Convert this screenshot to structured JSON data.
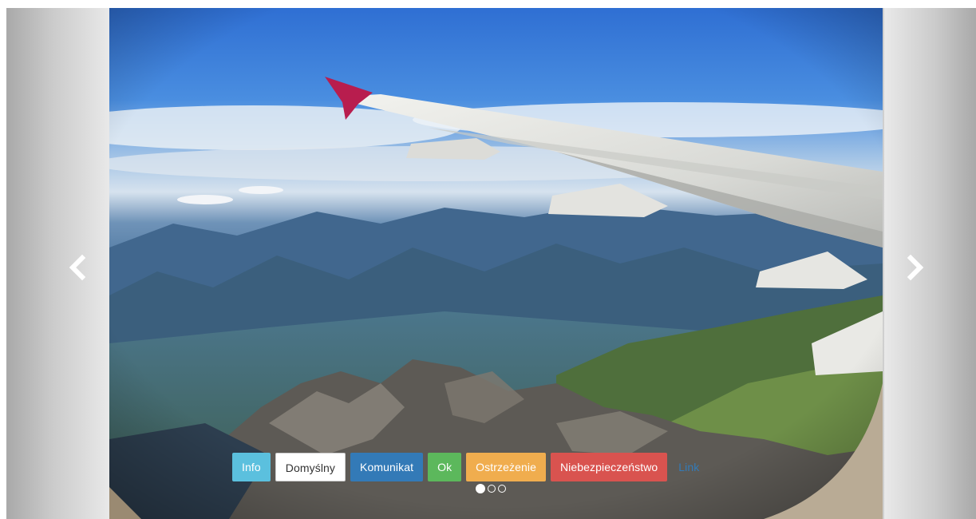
{
  "carousel": {
    "slide_image": "aerial-view-airplane-wing-over-mountains",
    "prev_icon": "chevron-left-icon",
    "next_icon": "chevron-right-icon",
    "buttons": [
      {
        "label": "Info",
        "style": "info"
      },
      {
        "label": "Domyślny",
        "style": "default"
      },
      {
        "label": "Komunikat",
        "style": "primary"
      },
      {
        "label": "Ok",
        "style": "success"
      },
      {
        "label": "Ostrzeżenie",
        "style": "warning"
      },
      {
        "label": "Niebezpieczeństwo",
        "style": "danger"
      },
      {
        "label": "Link",
        "style": "link"
      }
    ],
    "indicators": {
      "count": 3,
      "active_index": 0
    }
  },
  "colors": {
    "info": "#5bc0de",
    "default": "#ffffff",
    "primary": "#337ab7",
    "success": "#5cb85c",
    "warning": "#f0ad4e",
    "danger": "#d9534f",
    "link": "#337ab7"
  }
}
